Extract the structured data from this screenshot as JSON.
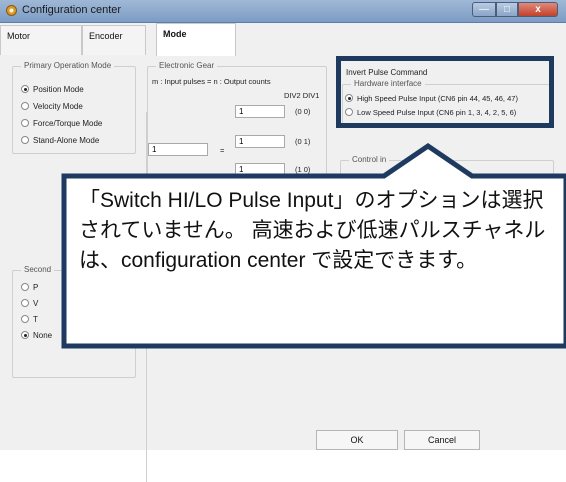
{
  "window": {
    "title": "Configuration center",
    "icon": "gear-icon",
    "controls": [
      "—",
      "□",
      "x"
    ]
  },
  "tabs": [
    {
      "label": "Motor"
    },
    {
      "label": "Encoder"
    },
    {
      "label": "Mode"
    }
  ],
  "primary_mode": {
    "label": "Primary Operation Mode",
    "options": [
      "Position Mode",
      "Velocity Mode",
      "Force/Torque Mode",
      "Stand-Alone Mode"
    ],
    "selected": "Position Mode"
  },
  "secondary_mode": {
    "label": "Second",
    "options_visible": [
      "P",
      "V",
      "T",
      "None"
    ],
    "selected": "None"
  },
  "electronic_gear": {
    "label": "Electronic Gear",
    "equation": "m : Input pulses   =   n : Output counts",
    "div_header": "DIV2 DIV1",
    "n_values": [
      "1",
      "1",
      "1"
    ],
    "div_values": [
      "(0 0)",
      "(0 1)",
      "(1 0)"
    ],
    "m_value": "1",
    "equals": "="
  },
  "invert_pulse": {
    "checkbox_label": "Invert Pulse Command",
    "group_label": "Hardware interface",
    "options": [
      "High Speed Pulse Input (CN6 pin 44, 45, 46, 47)",
      "Low Speed Pulse Input (CN6 pin 1, 3, 4, 2, 5, 6)"
    ],
    "selected": "High Speed Pulse Input (CN6 pin 44, 45, 46, 47)"
  },
  "control_input": {
    "label": "Control in"
  },
  "callout": {
    "text": "「Switch HI/LO Pulse Input」のオプションは選択されていません。 高速および低速パルスチャネルは、configuration center で設定できます。"
  },
  "footer": {
    "ok_label": "OK",
    "cancel_label": "Cancel"
  },
  "colors": {
    "highlight_border": "#1e3a5f",
    "title_bar": "#8aa5c8"
  }
}
